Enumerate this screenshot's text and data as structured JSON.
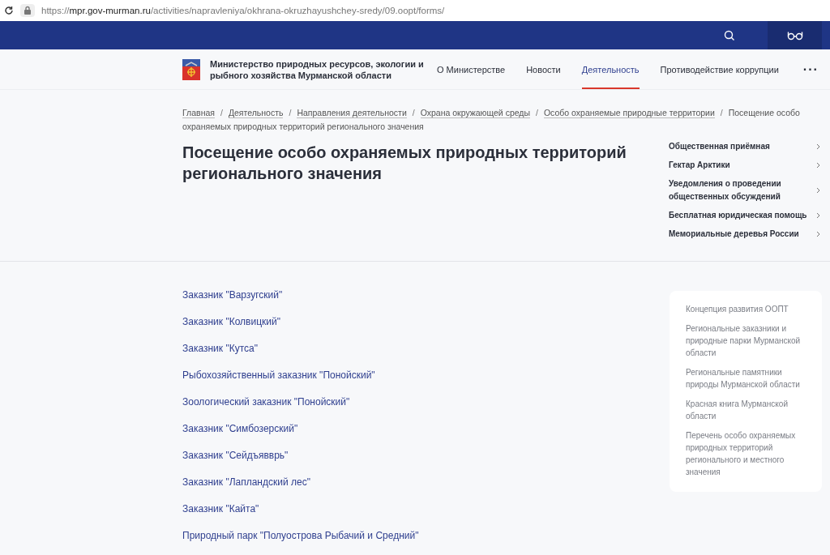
{
  "browser": {
    "url": "https://**mpr.gov-murman.ru**/activities/napravleniya/okhrana-okruzhayushchey-sredy/09.oopt/forms/"
  },
  "header": {
    "org_name": "Министерство природных ресурсов, экологии и рыбного хозяйства Мурманской области",
    "nav": [
      {
        "label": "О Министерстве",
        "selected": false
      },
      {
        "label": "Новости",
        "selected": false
      },
      {
        "label": "Деятельность",
        "selected": true
      },
      {
        "label": "Противодействие коррупции",
        "selected": false
      }
    ],
    "more": "···"
  },
  "breadcrumbs": [
    {
      "label": "Главная",
      "separator": "/"
    },
    {
      "label": "Деятельность",
      "separator": "/"
    },
    {
      "label": "Направления деятельности",
      "separator": "/"
    },
    {
      "label": "Охрана окружающей среды",
      "separator": "/"
    },
    {
      "label": "Особо охраняемые природные территории",
      "separator": "/"
    }
  ],
  "breadcrumb_current": [
    "Посещение особо",
    "охраняемых природных территорий регионального значения"
  ],
  "page_title": "Посещение особо охраняемых природных территорий регионального значения",
  "quick_links": [
    "Общественная приёмная",
    "Гектар Арктики",
    "Уведомления о проведении общественных обсуждений",
    "Бесплатная юридическая помощь",
    "Мемориальные деревья России"
  ],
  "documents": [
    "Заказник \"Варзугский\"",
    "Заказник \"Колвицкий\"",
    "Заказник \"Кутса\"",
    "Рыбохозяйственный заказник \"Понойский\"",
    "Зоологический заказник \"Понойский\"",
    "Заказник \"Симбозерский\"",
    "Заказник \"Сейдъявврь\"",
    "Заказник \"Лапландский лес\"",
    "Заказник \"Кайта\"",
    "Природный парк \"Полуострова Рыбачий и Средний\""
  ],
  "side_menu": [
    "Концепция развития ООПТ",
    "Региональные заказники и природные парки Мурманской области",
    "Региональные памятники природы Мурманской области",
    "Красная книга Мурманской области",
    "Перечень особо охраняемых природных территорий регионального и местного значения"
  ]
}
